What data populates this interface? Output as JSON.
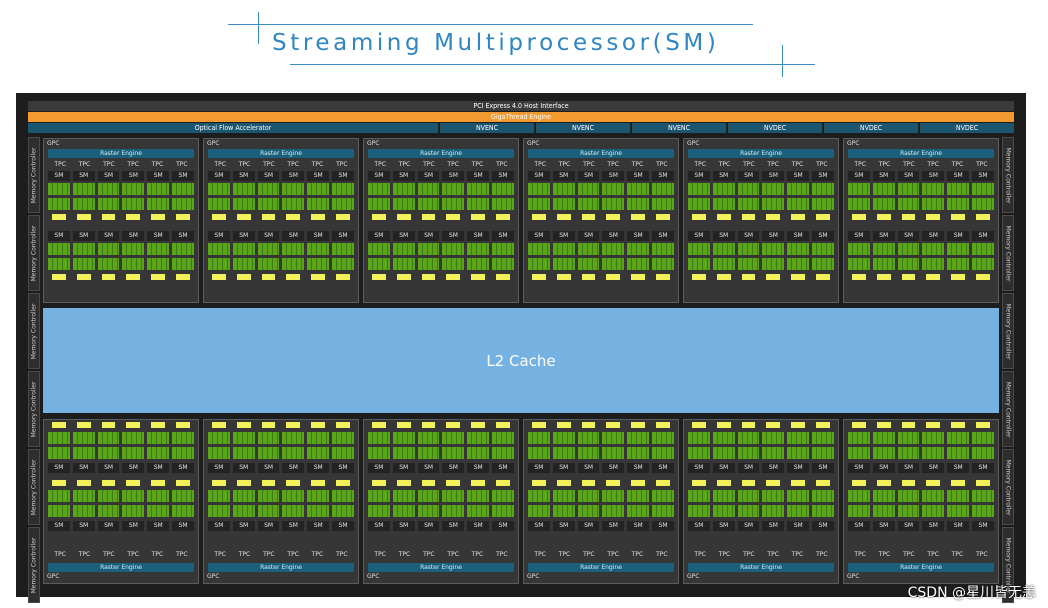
{
  "title": "Streaming Multiprocessor(SM)",
  "watermark": "CSDN @星川皆无恙",
  "chip": {
    "pcie": "PCI Express 4.0 Host Interface",
    "gigathread": "GigaThread Engine",
    "engines": [
      "Optical Flow Accelerator",
      "NVENC",
      "NVENC",
      "NVENC",
      "NVDEC",
      "NVDEC",
      "NVDEC"
    ],
    "memory_controller": "Memory Controller",
    "gpc_label": "GPC",
    "raster_label": "Raster Engine",
    "tpc_label": "TPC",
    "sm_label": "SM",
    "l2": "L2 Cache",
    "gpcs_per_row": 6,
    "tpcs_per_gpc": 6,
    "colors": {
      "orange": "#f29a2f",
      "teal": "#1c5570",
      "l2_blue": "#75b2e2",
      "core_green": "#5aa619",
      "yellow": "#f1f25a"
    }
  }
}
